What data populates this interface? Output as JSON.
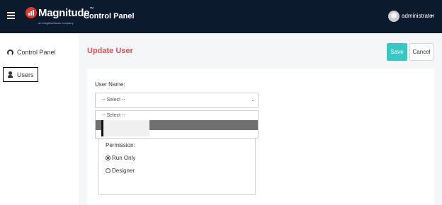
{
  "header": {
    "brand": "Magnitude",
    "brand_tm": "™",
    "brand_sub": "an insightsoftware company",
    "title": "Control Panel",
    "user": "administrator",
    "user_caret": "▾"
  },
  "sidebar": {
    "items": [
      {
        "label": "Control Panel",
        "icon": "gauge-icon"
      },
      {
        "label": "Users",
        "icon": "user-icon"
      }
    ]
  },
  "page": {
    "title": "Update User",
    "save": "Save",
    "cancel": "Cancel"
  },
  "form": {
    "user_name_label": "User Name:",
    "user_select_value": "-- Select --",
    "dropdown_options": [
      "-- Select --"
    ],
    "permission_label": "Permission:",
    "permissions": [
      {
        "label": "Run Only",
        "checked": true
      },
      {
        "label": "Designer",
        "checked": false
      }
    ]
  },
  "colors": {
    "topbar": "#0b1a2c",
    "accent_title": "#e94e52",
    "save_button": "#37c8c4",
    "logo": "#e03a2e"
  }
}
